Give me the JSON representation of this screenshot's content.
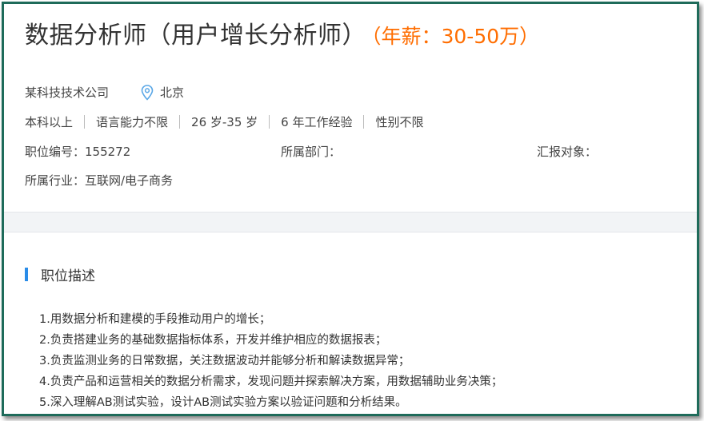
{
  "job": {
    "title": "数据分析师（用户增长分析师）",
    "salary": "（年薪：30-50万）"
  },
  "company": {
    "name": "某科技技术公司",
    "location": "北京"
  },
  "requirements": [
    "本科以上",
    "语言能力不限",
    "26 岁-35 岁",
    "6 年工作经验",
    "性别不限"
  ],
  "meta": {
    "job_id": "职位编号：155272",
    "department": "所属部门：",
    "report_to": "汇报对象："
  },
  "industry": "所属行业：互联网/电子商务",
  "description": {
    "heading": "职位描述",
    "items": [
      "1.用数据分析和建模的手段推动用户的增长；",
      "2.负责搭建业务的基础数据指标体系，开发并维护相应的数据报表；",
      "3.负责监测业务的日常数据，关注数据波动并能够分析和解读数据异常；",
      "4.负责产品和运营相关的数据分析需求，发现问题并探索解决方案，用数据辅助业务决策；",
      "5.深入理解AB测试实验，设计AB测试实验方案以验证问题和分析结果。"
    ]
  },
  "colors": {
    "salary": "#ff6d00",
    "accent_bar": "#2a8ce8",
    "location_icon": "#5aa7e6",
    "frame_border": "#1e6b5a"
  },
  "icons": {
    "location": "map-pin-icon"
  }
}
